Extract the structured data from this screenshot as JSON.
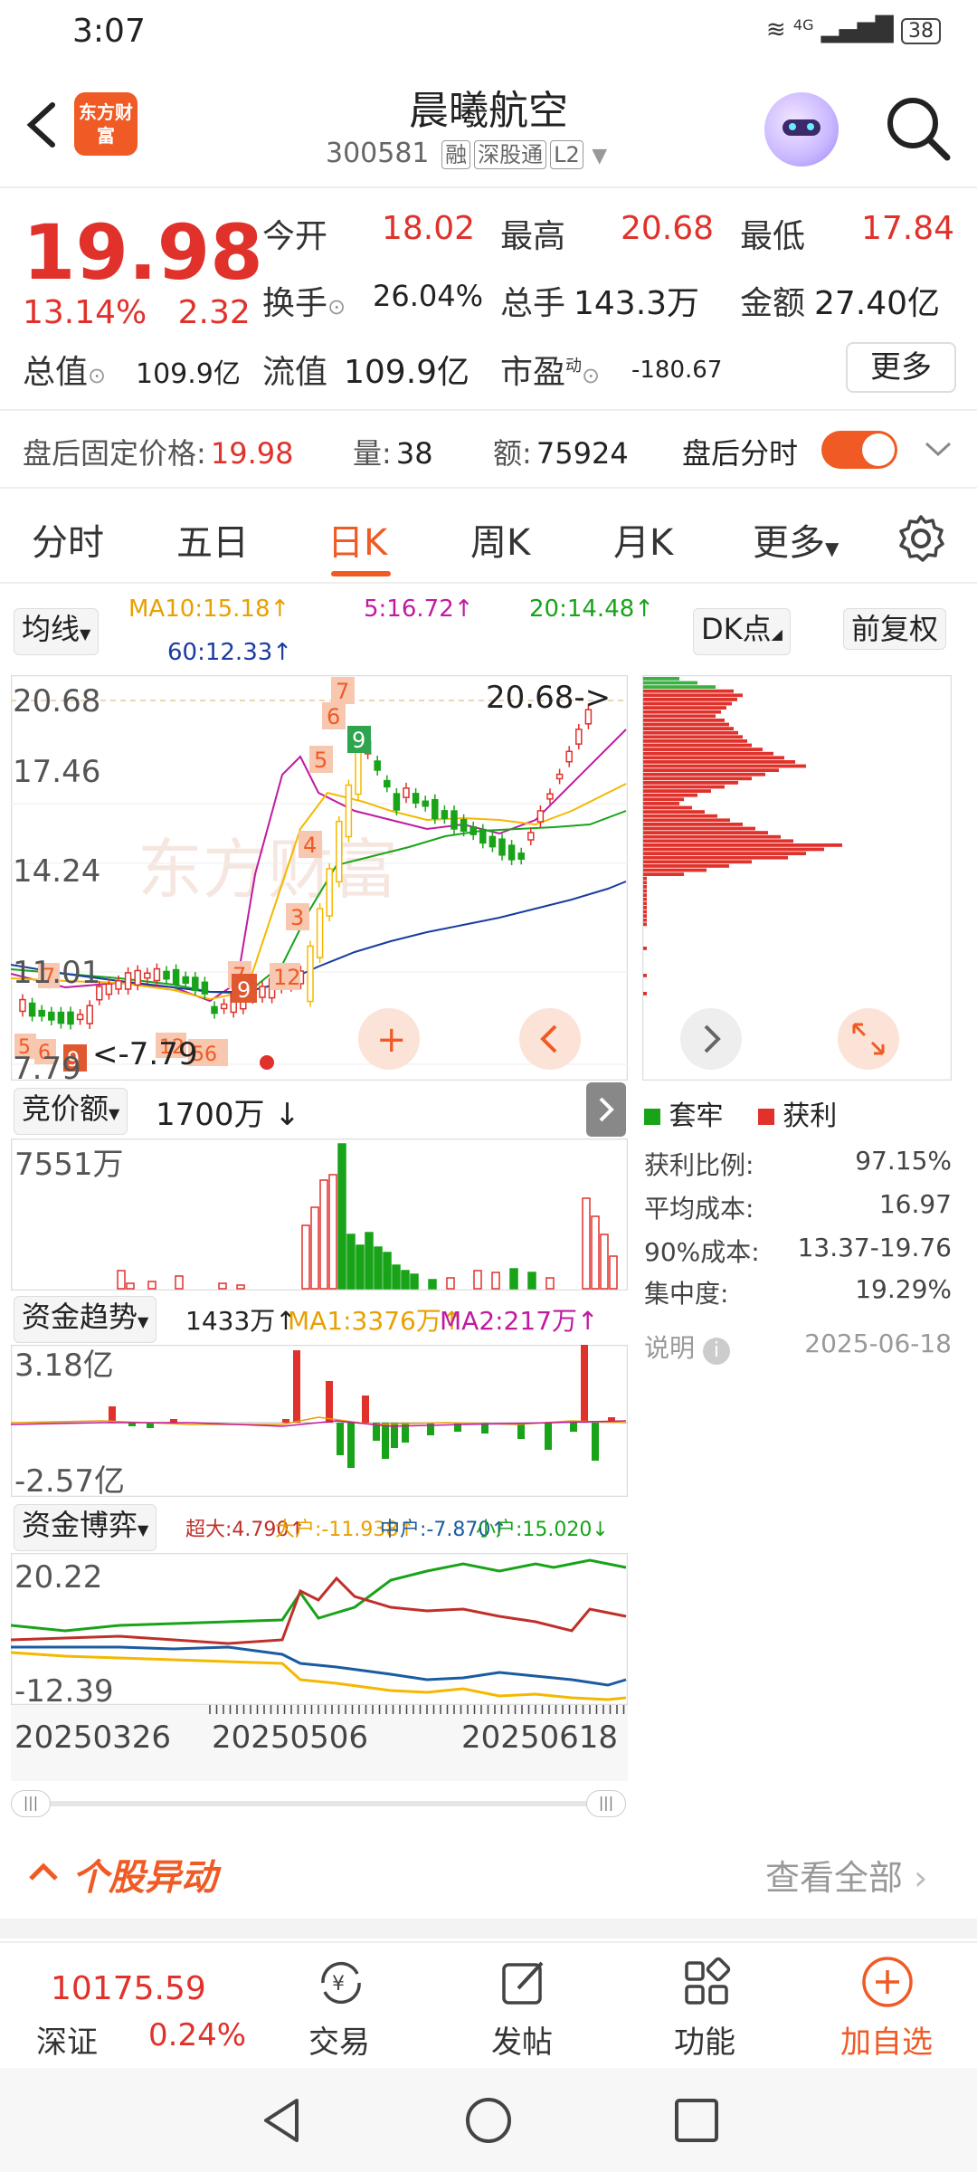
{
  "status": {
    "time": "3:07",
    "signal": "4G",
    "battery": "38"
  },
  "header": {
    "title": "晨曦航空",
    "code": "300581",
    "tag1": "融",
    "tag2": "深股通",
    "tag3": "L2",
    "logo_text": "东方财富"
  },
  "quote": {
    "price": "19.98",
    "pct": "13.14%",
    "chg": "2.32",
    "open_label": "今开",
    "open": "18.02",
    "high_label": "最高",
    "high": "20.68",
    "low_label": "最低",
    "low": "17.84",
    "turnover_label": "换手",
    "turnover": "26.04%",
    "volume_label": "总手",
    "volume": "143.3万",
    "amount_label": "金额",
    "amount": "27.40亿",
    "mcap_label": "总值",
    "mcap": "109.9亿",
    "float_label": "流值",
    "float": "109.9亿",
    "pe_label": "市盈",
    "pe_sup": "动",
    "pe": "-180.67",
    "more": "更多"
  },
  "afterhours": {
    "price_label": "盘后固定价格:",
    "price": "19.98",
    "qty_label": "量:",
    "qty": "38",
    "amt_label": "额:",
    "amt": "75924",
    "toggle_label": "盘后分时"
  },
  "tabs": [
    "分时",
    "五日",
    "日K",
    "周K",
    "月K",
    "更多"
  ],
  "chart": {
    "ma_select": "均线",
    "ma10": "MA10:15.18↑",
    "ma5": "5:16.72↑",
    "ma20": "20:14.48↑",
    "ma60": "60:12.33↑",
    "dk_btn": "DK点",
    "adjust_btn": "前复权",
    "y_ticks": [
      "20.68",
      "17.46",
      "14.24",
      "11.01",
      "7.79"
    ],
    "max_marker": "20.68->",
    "min_marker": "<-7.79",
    "vol_select": "竞价额",
    "vol_value": "1700万 ↓",
    "vol_top": "7551万",
    "flow_select": "资金趋势",
    "flow_value": "1433万↑",
    "flow_ma1": "MA1:3376万↑",
    "flow_ma2": "MA2:217万↑",
    "flow_top": "3.18亿",
    "flow_bottom": "-2.57亿",
    "game_select": "资金博弈",
    "game_super": "超大:4.790↑",
    "game_big": "大户:-11.938↑",
    "game_mid": "中户:-7.870↑",
    "game_small": "小户:15.020↓",
    "game_top": "20.22",
    "game_bottom": "-12.39",
    "dates": [
      "20250326",
      "20250506",
      "20250618"
    ],
    "watermark": "东方财富"
  },
  "chips": {
    "legend_trapped": "套牢",
    "legend_profit": "获利",
    "rows": [
      {
        "label": "获利比例:",
        "value": "97.15%"
      },
      {
        "label": "平均成本:",
        "value": "16.97"
      },
      {
        "label": "90%成本:",
        "value": "13.37-19.76"
      },
      {
        "label": "集中度:",
        "value": "19.29%"
      }
    ],
    "note_label": "说明",
    "note_date": "2025-06-18"
  },
  "section": {
    "title": "个股异动",
    "link": "查看全部"
  },
  "bottom_nav": {
    "index_value": "10175.59",
    "index_name": "深证",
    "index_pct": "0.24%",
    "trade": "交易",
    "post": "发帖",
    "func": "功能",
    "add": "加自选"
  },
  "colors": {
    "up": "#e0312b",
    "down": "#19a319",
    "accent": "#f05a24"
  }
}
